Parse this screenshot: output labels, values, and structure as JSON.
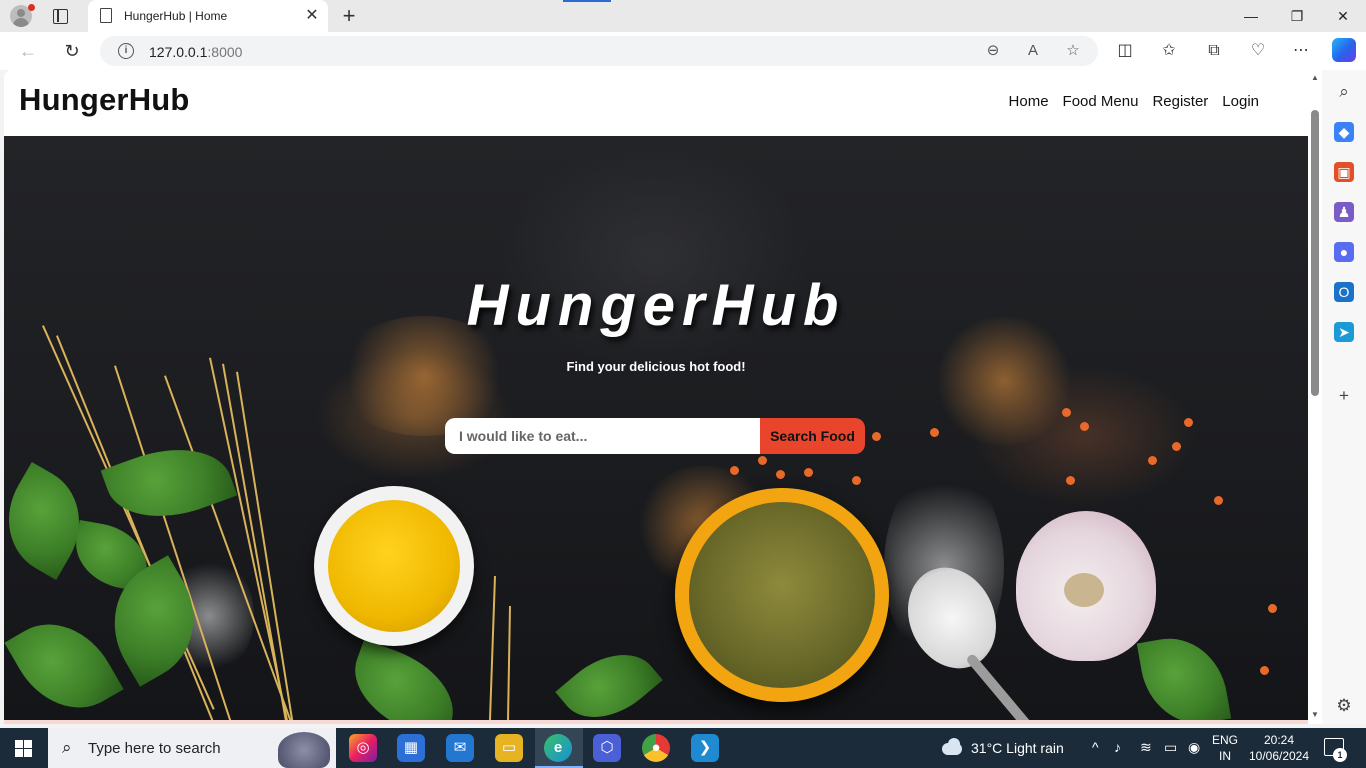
{
  "browser": {
    "tab_title": "HungerHub | Home",
    "tab_close": "✕",
    "new_tab": "+",
    "url_host": "127.0.0.1",
    "url_port": ":8000",
    "window_minimize": "—",
    "window_restore": "❐",
    "window_close": "✕"
  },
  "site": {
    "brand": "HungerHub",
    "nav": [
      {
        "label": "Home"
      },
      {
        "label": "Food Menu"
      },
      {
        "label": "Register"
      },
      {
        "label": "Login"
      }
    ]
  },
  "hero": {
    "title": "HungerHub",
    "subtitle": "Find your delicious hot food!",
    "search_placeholder": "I would like to eat...",
    "search_button": "Search Food"
  },
  "taskbar": {
    "search_placeholder": "Type here to search",
    "weather": "31°C  Light rain",
    "language_line1": "ENG",
    "language_line2": "IN",
    "time": "20:24",
    "date": "10/06/2024",
    "notification_count": "1"
  },
  "colors": {
    "accent_button": "#e8452c",
    "hero_background": "#1b1c1f",
    "taskbar": "#1c2b3a"
  }
}
